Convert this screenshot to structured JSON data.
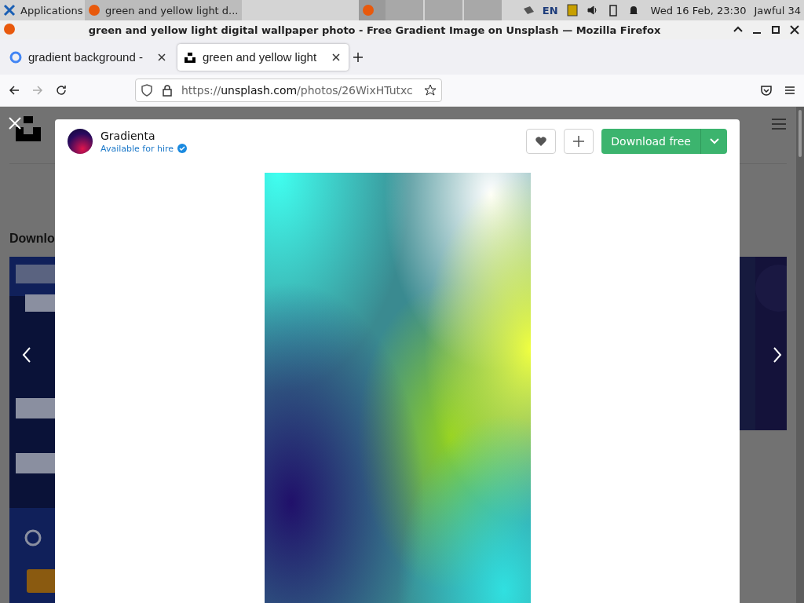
{
  "taskbar": {
    "apps_menu": "Applications",
    "task": "green and yellow light d...",
    "keyboard": "EN",
    "clock": "Wed 16 Feb, 23:30",
    "user": "Jawful 34"
  },
  "window": {
    "title": "green and yellow light digital wallpaper photo - Free Gradient Image on Unsplash — Mozilla Firefox"
  },
  "tabs": [
    {
      "label": "gradient background -",
      "selected": false
    },
    {
      "label": "green and yellow light",
      "selected": true
    }
  ],
  "address": {
    "prefix": "https://",
    "domain": "unsplash.com",
    "path": "/photos/26WixHTutxc"
  },
  "background_page": {
    "heading": "Downlo"
  },
  "modal": {
    "author": "Gradienta",
    "hire": "Available for hire",
    "download": "Download free"
  }
}
